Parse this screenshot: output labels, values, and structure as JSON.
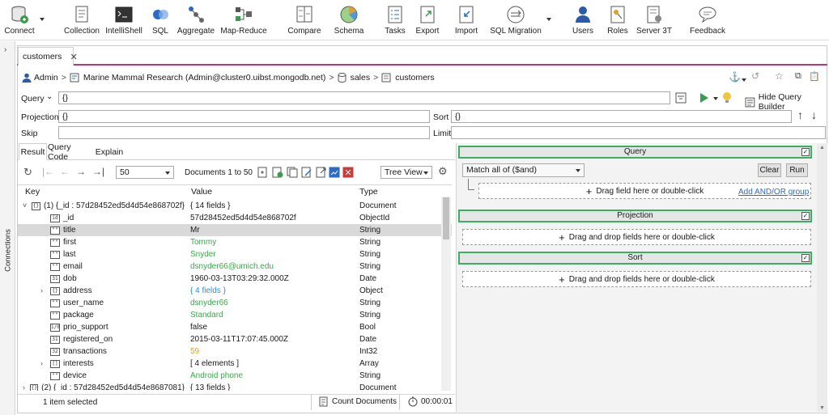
{
  "toolbar": {
    "connect": "Connect",
    "collection": "Collection",
    "intellishell": "IntelliShell",
    "sql": "SQL",
    "aggregate": "Aggregate",
    "mapreduce": "Map-Reduce",
    "compare": "Compare",
    "schema": "Schema",
    "tasks": "Tasks",
    "export": "Export",
    "import": "Import",
    "sql_migration": "SQL Migration",
    "users": "Users",
    "roles": "Roles",
    "server3t": "Server 3T",
    "feedback": "Feedback"
  },
  "sidebar": {
    "connections_label": "Connections"
  },
  "tab": {
    "title": "customers"
  },
  "breadcrumb": {
    "user": "Admin",
    "connection": "Marine Mammal Research (Admin@cluster0.uibst.mongodb.net)",
    "database": "sales",
    "collection": "customers"
  },
  "query": {
    "query_label": "Query",
    "query_value": "{}",
    "projection_label": "Projection",
    "projection_value": "{}",
    "sort_label": "Sort",
    "sort_value": "{}",
    "skip_label": "Skip",
    "limit_label": "Limit",
    "hide_builder": "Hide Query Builder"
  },
  "result_tabs": [
    "Result",
    "Query Code",
    "Explain"
  ],
  "result_toolbar": {
    "page_size": "50",
    "documents_range": "Documents 1 to 50",
    "view_mode": "Tree View"
  },
  "grid": {
    "headers": {
      "key": "Key",
      "value": "Value",
      "type": "Type"
    },
    "rows": [
      {
        "key": "(1) {_id : 57d28452ed5d4d54e868702f}",
        "value": "{ 14 fields }",
        "type": "Document",
        "icon": "{}"
      },
      {
        "key": "_id",
        "value": "57d28452ed5d4d54e868702f",
        "type": "ObjectId",
        "icon": "id"
      },
      {
        "key": "title",
        "value": "Mr",
        "type": "String",
        "icon": "\"\""
      },
      {
        "key": "first",
        "value": "Tommy",
        "type": "String",
        "icon": "\"\""
      },
      {
        "key": "last",
        "value": "Snyder",
        "type": "String",
        "icon": "\"\""
      },
      {
        "key": "email",
        "value": "dsnyder66@umich.edu",
        "type": "String",
        "icon": "\"\""
      },
      {
        "key": "dob",
        "value": "1960-03-13T03:29:32.000Z",
        "type": "Date",
        "icon": "31"
      },
      {
        "key": "address",
        "value": "{ 4 fields }",
        "type": "Object",
        "icon": "{}"
      },
      {
        "key": "user_name",
        "value": "dsnyder66",
        "type": "String",
        "icon": "\"\""
      },
      {
        "key": "package",
        "value": "Standard",
        "type": "String",
        "icon": "\"\""
      },
      {
        "key": "prio_support",
        "value": "false",
        "type": "Bool",
        "icon": "1/0"
      },
      {
        "key": "registered_on",
        "value": "2015-03-11T17:07:45.000Z",
        "type": "Date",
        "icon": "31"
      },
      {
        "key": "transactions",
        "value": "59",
        "type": "Int32",
        "icon": "32"
      },
      {
        "key": "interests",
        "value": "[ 4 elements ]",
        "type": "Array",
        "icon": "[]"
      },
      {
        "key": "device",
        "value": "Android phone",
        "type": "String",
        "icon": "\"\""
      },
      {
        "key": "(2) {_id : 57d28452ed5d4d54e8687081}",
        "value": "{ 13 fields }",
        "type": "Document",
        "icon": "{}"
      }
    ]
  },
  "status": {
    "selected": "1 item selected",
    "count_documents": "Count Documents",
    "elapsed": "00:00:01"
  },
  "query_builder": {
    "query_header": "Query",
    "match_mode": "Match all of ($and)",
    "clear": "Clear",
    "run": "Run",
    "drag_field": "Drag field here or double-click",
    "add_group": "Add AND/OR group",
    "projection_header": "Projection",
    "projection_drop": "Drag and drop fields here or double-click",
    "sort_header": "Sort",
    "sort_drop": "Drag and drop fields here or double-click"
  }
}
